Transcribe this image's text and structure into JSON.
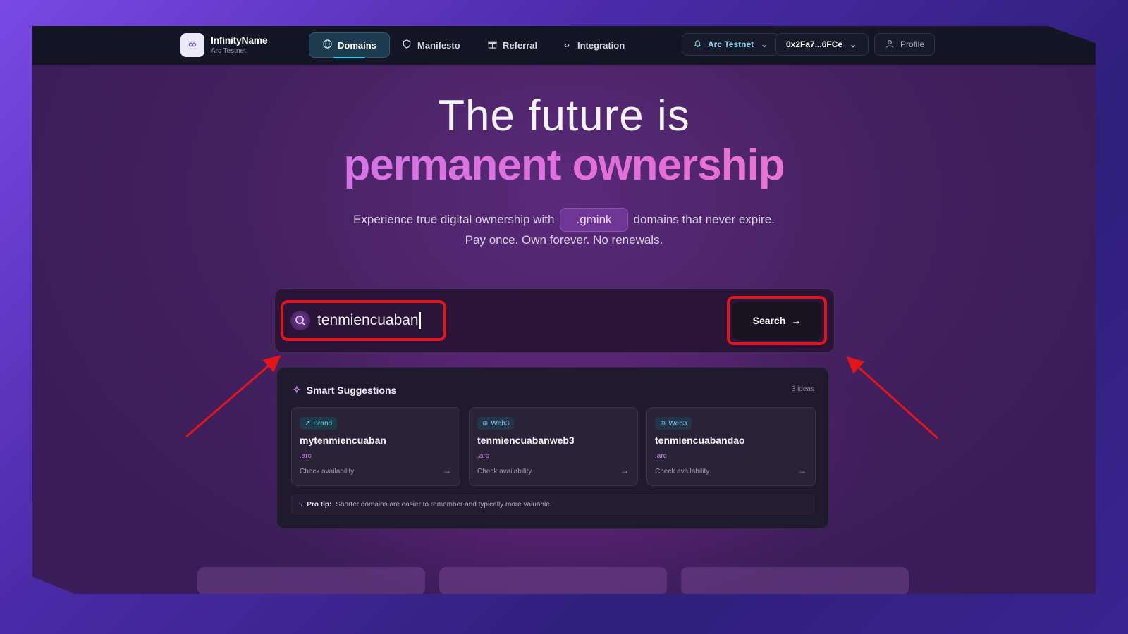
{
  "app": {
    "name": "InfinityName",
    "network_sub": "Arc Testnet",
    "logo_glyph": "∞"
  },
  "nav": {
    "items": [
      {
        "label": "Domains",
        "icon": "globe-icon",
        "active": true
      },
      {
        "label": "Manifesto",
        "icon": "shield-icon",
        "active": false
      },
      {
        "label": "Referral",
        "icon": "gift-icon",
        "active": false
      },
      {
        "label": "Integration",
        "icon": "code-icon",
        "active": false
      }
    ],
    "network_label": "Arc Testnet",
    "wallet_label": "0x2Fa7...6FCe",
    "profile_label": "Profile"
  },
  "hero": {
    "line1": "The future is",
    "line2": "permanent ownership",
    "sub_before": "Experience true digital ownership with",
    "chip": ".gmink",
    "sub_after": "domains that never expire.",
    "sub2": "Pay once. Own forever. No renewals."
  },
  "search": {
    "value": "tenmiencuaban",
    "button_label": "Search"
  },
  "suggestions": {
    "title": "Smart Suggestions",
    "count_label": "3 ideas",
    "cards": [
      {
        "tag": "Brand",
        "name": "mytenmiencuaban",
        "tld": ".arc",
        "check": "Check availability"
      },
      {
        "tag": "Web3",
        "name": "tenmiencuabanweb3",
        "tld": ".arc",
        "check": "Check availability"
      },
      {
        "tag": "Web3",
        "name": "tenmiencuabandao",
        "tld": ".arc",
        "check": "Check availability"
      }
    ],
    "tip_label": "Pro tip:",
    "tip_text": "Shorter domains are easier to remember and typically more valuable."
  },
  "colors": {
    "accent_cyan": "#36c6e6",
    "highlight_red": "#e4141c",
    "brand_purple": "#c779f5"
  }
}
